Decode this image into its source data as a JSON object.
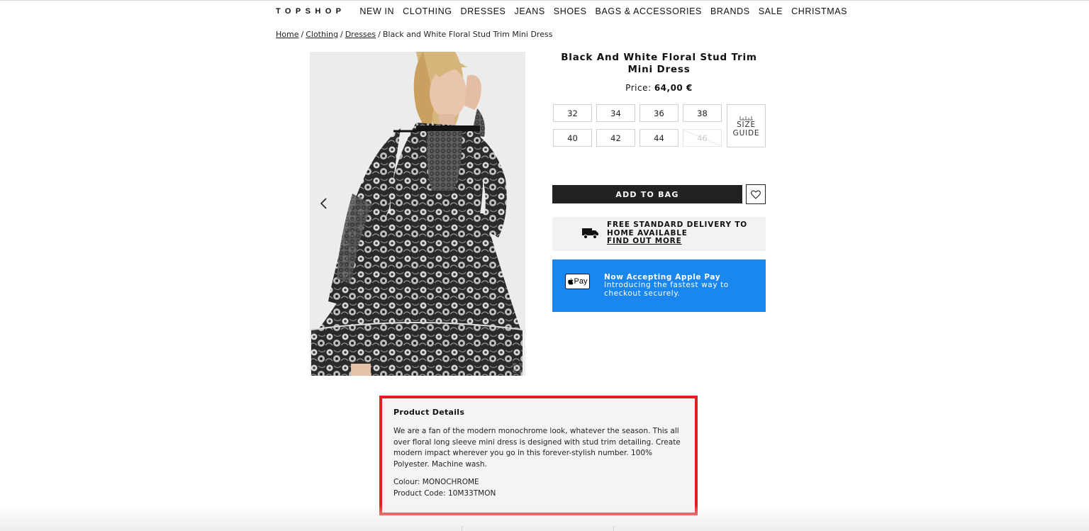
{
  "header": {
    "logo": "TOPSHOP",
    "nav": [
      "NEW IN",
      "CLOTHING",
      "DRESSES",
      "JEANS",
      "SHOES",
      "BAGS & ACCESSORIES",
      "BRANDS",
      "SALE",
      "CHRISTMAS"
    ]
  },
  "breadcrumb": {
    "home": "Home",
    "clothing": "Clothing",
    "dresses": "Dresses",
    "current": "Black and White Floral Stud Trim Mini Dress",
    "separator": "/"
  },
  "product": {
    "title": "Black And White Floral Stud Trim Mini Dress",
    "price_label": "Price:",
    "price_value": "64,00 €",
    "sizes": [
      {
        "label": "32",
        "available": true
      },
      {
        "label": "34",
        "available": true
      },
      {
        "label": "36",
        "available": true
      },
      {
        "label": "38",
        "available": true
      },
      {
        "label": "40",
        "available": true
      },
      {
        "label": "42",
        "available": true
      },
      {
        "label": "44",
        "available": true
      },
      {
        "label": "46",
        "available": false
      }
    ],
    "size_guide_line1": "SIZE",
    "size_guide_line2": "GUIDE",
    "add_to_bag": "ADD TO BAG"
  },
  "delivery": {
    "line1": "FREE STANDARD DELIVERY TO",
    "line2": "HOME AVAILABLE",
    "link": "FIND OUT MORE"
  },
  "applepay": {
    "badge": "Pay",
    "title": "Now Accepting Apple Pay",
    "description": "Introducing the fastest way to checkout securely.",
    "color": "#1a86f0"
  },
  "details": {
    "heading": "Product Details",
    "description": "We are a fan of the modern monochrome look, whatever the season. This all over floral long sleeve mini dress is designed with stud trim detailing. Create modern impact wherever you go in this forever-stylish number. 100% Polyester. Machine wash.",
    "colour": "Colour: MONOCHROME",
    "product_code": "Product Code: 10M33TMON",
    "highlight_color": "#e02020"
  }
}
